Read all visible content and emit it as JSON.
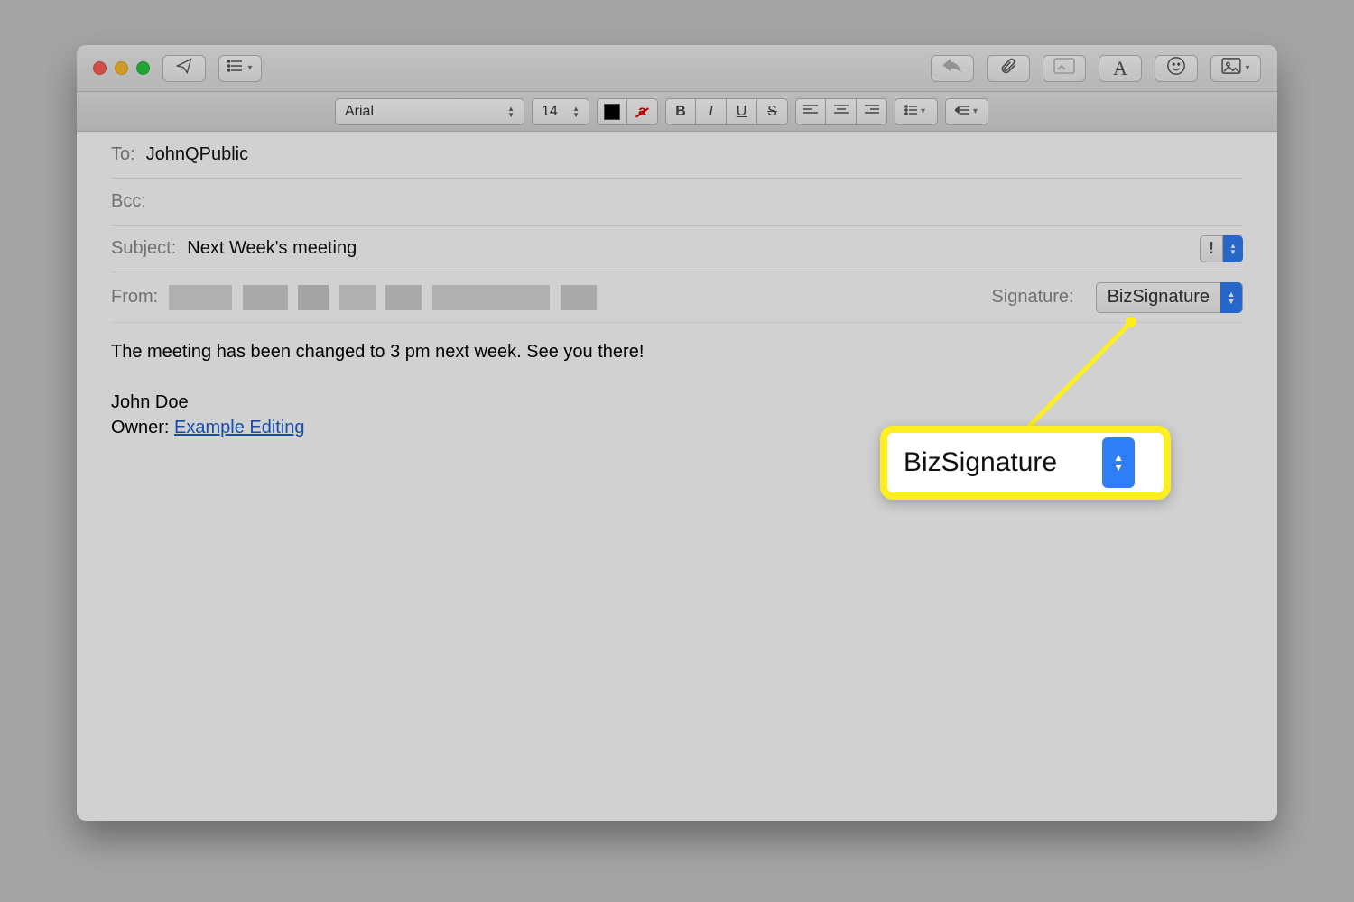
{
  "toolbar": {
    "send": "send-icon",
    "show_fields": "list-icon"
  },
  "format": {
    "font": "Arial",
    "size": "14",
    "bold": "B",
    "italic": "I",
    "underline": "U",
    "strike": "S",
    "redA": "a"
  },
  "headers": {
    "to_label": "To:",
    "to_value": "JohnQPublic",
    "bcc_label": "Bcc:",
    "subject_label": "Subject:",
    "subject_value": "Next Week's meeting",
    "from_label": "From:",
    "priority": "!",
    "signature_label": "Signature:",
    "signature_value": "BizSignature"
  },
  "body": {
    "line1": "The meeting has been changed to 3 pm next week. See you there!",
    "name": "John Doe",
    "owner_label": "Owner: ",
    "link_text": "Example Editing"
  },
  "callout": {
    "text": "BizSignature"
  }
}
